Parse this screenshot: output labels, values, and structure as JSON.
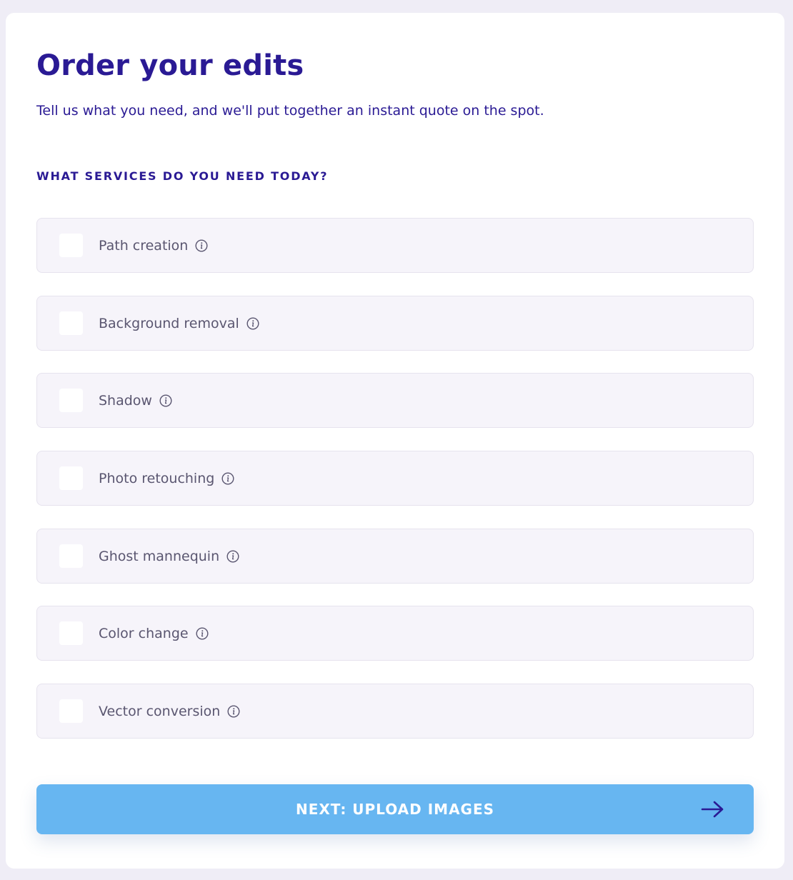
{
  "header": {
    "title": "Order your edits",
    "subtitle": "Tell us what you need, and we'll put together an instant quote on the spot."
  },
  "services": {
    "heading": "WHAT SERVICES DO YOU NEED TODAY?",
    "options": [
      {
        "label": "Path creation",
        "checked": false,
        "icon": "info-icon"
      },
      {
        "label": "Background removal",
        "checked": false,
        "icon": "info-icon"
      },
      {
        "label": "Shadow",
        "checked": false,
        "icon": "info-icon"
      },
      {
        "label": "Photo retouching",
        "checked": false,
        "icon": "info-icon"
      },
      {
        "label": "Ghost mannequin",
        "checked": false,
        "icon": "info-icon"
      },
      {
        "label": "Color change",
        "checked": false,
        "icon": "info-icon"
      },
      {
        "label": "Vector conversion",
        "checked": false,
        "icon": "info-icon"
      }
    ]
  },
  "actions": {
    "next_label": "NEXT: UPLOAD IMAGES",
    "next_icon": "arrow-right-icon"
  },
  "colors": {
    "primary_text": "#2a1a94",
    "button_bg": "#67b6f1",
    "option_bg": "#f6f4fa",
    "page_bg": "#efedf6"
  }
}
